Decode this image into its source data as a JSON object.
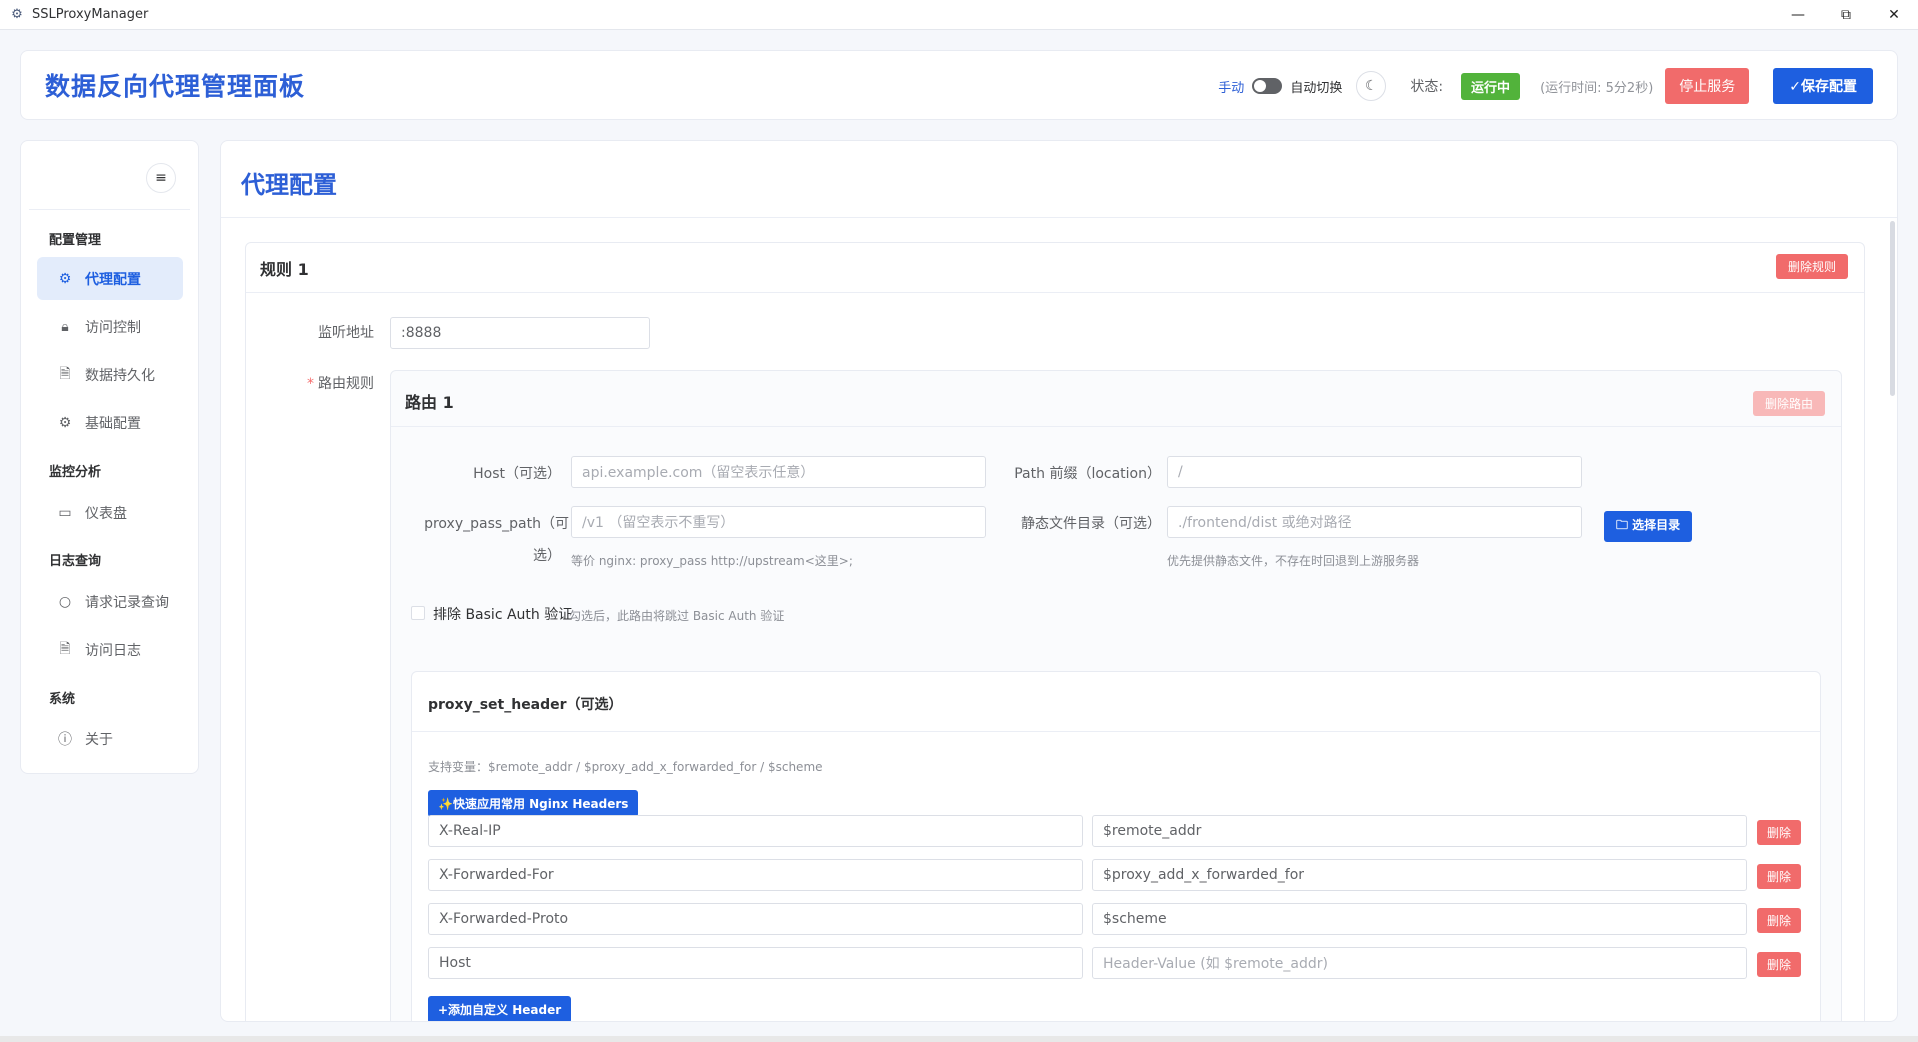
{
  "window": {
    "title": "SSLProxyManager",
    "minimize": "—",
    "maximize": "⧉",
    "close": "✕"
  },
  "header": {
    "brand": "数据反向代理管理面板",
    "mode_manual": "手动",
    "mode_auto": "自动切换",
    "status_label": "状态:",
    "status_value": "运行中",
    "uptime": "(运行时间: 5分2秒)",
    "stop_button": "停止服务",
    "save_button": "✓保存配置",
    "colors": {
      "accent": "#1e5fe0",
      "running": "#52b33b",
      "danger": "#f16b6b"
    }
  },
  "sidebar": {
    "groups": [
      {
        "label": "配置管理"
      },
      {
        "label": "监控分析"
      },
      {
        "label": "日志查询"
      },
      {
        "label": "系统"
      }
    ],
    "items": [
      {
        "label": "代理配置",
        "icon": "gear-icon",
        "active": true
      },
      {
        "label": "访问控制",
        "icon": "lock-icon"
      },
      {
        "label": "数据持久化",
        "icon": "document-icon"
      },
      {
        "label": "基础配置",
        "icon": "gear-icon"
      },
      {
        "label": "仪表盘",
        "icon": "dashboard-icon"
      },
      {
        "label": "请求记录查询",
        "icon": "search-icon"
      },
      {
        "label": "访问日志",
        "icon": "document-icon"
      },
      {
        "label": "关于",
        "icon": "info-icon"
      }
    ]
  },
  "main": {
    "page_title": "代理配置",
    "rule": {
      "title": "规则 1",
      "delete_button": "删除规则",
      "listen_label": "监听地址",
      "listen_value": ":8888",
      "routes_label": "路由规则",
      "route": {
        "title": "路由 1",
        "delete_button": "删除路由",
        "host_label": "Host（可选）",
        "host_placeholder": "api.example.com（留空表示任意）",
        "path_label": "Path 前缀（location）",
        "path_placeholder": "/",
        "proxy_pass_label_1": "proxy_pass_path（可",
        "proxy_pass_label_2": "选）",
        "proxy_pass_placeholder": "/v1 （留空表示不重写）",
        "proxy_pass_hint": "等价 nginx: proxy_pass http://upstream<这里>;",
        "static_label": "静态文件目录（可选）",
        "static_placeholder": "./frontend/dist 或绝对路径",
        "static_hint": "优先提供静态文件，不存在时回退到上游服务器",
        "pick_dir_button": "🗀 选择目录",
        "exclude_auth_label": "排除 Basic Auth 验证",
        "exclude_auth_hint": "勾选后，此路由将跳过 Basic Auth 验证",
        "set_header": {
          "title": "proxy_set_header（可选）",
          "vars_hint": "支持变量：$remote_addr / $proxy_add_x_forwarded_for / $scheme",
          "quick_button": "✨快速应用常用 Nginx Headers",
          "delete_label": "删除",
          "add_button": "+添加自定义 Header",
          "rows": [
            {
              "key": "X-Real-IP",
              "value": "$remote_addr",
              "value_placeholder": false
            },
            {
              "key": "X-Forwarded-For",
              "value": "$proxy_add_x_forwarded_for",
              "value_placeholder": false
            },
            {
              "key": "X-Forwarded-Proto",
              "value": "$scheme",
              "value_placeholder": false
            },
            {
              "key": "Host",
              "value": "Header-Value (如 $remote_addr)",
              "value_placeholder": true
            }
          ]
        }
      }
    }
  }
}
